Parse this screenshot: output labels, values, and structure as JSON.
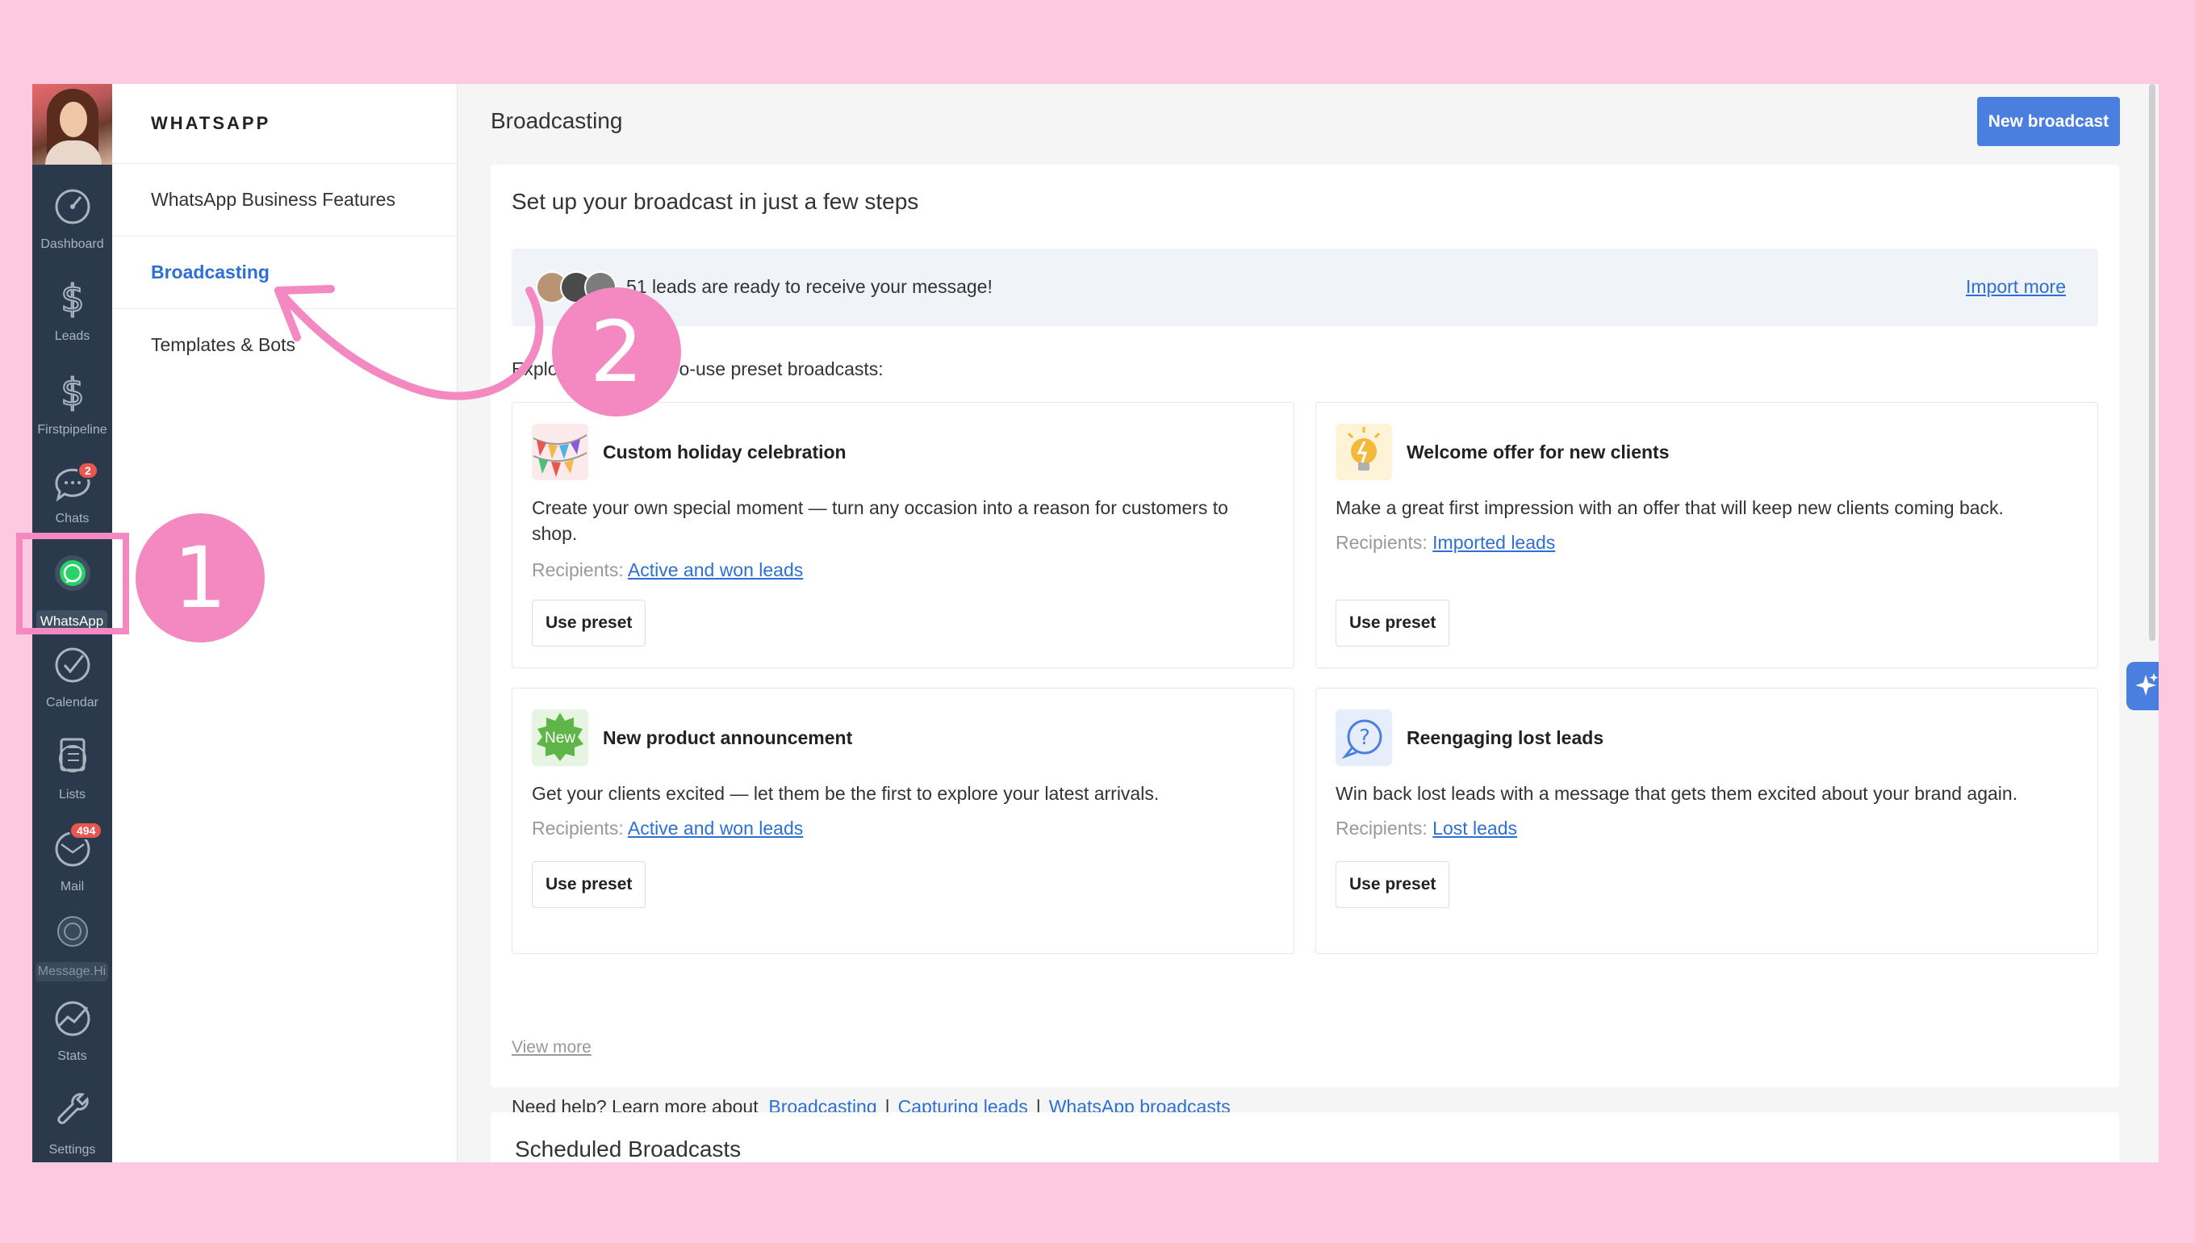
{
  "colors": {
    "background": "#fcc9e1",
    "rail": "#2a3a4c",
    "accent": "#4a7fe0",
    "link": "#2d6fd4",
    "annotation": "#f489c2",
    "badge": "#e8564f"
  },
  "rail": {
    "items": [
      {
        "label": "Dashboard",
        "icon": "dashboard-gauge-icon"
      },
      {
        "label": "Leads",
        "icon": "dollar-icon"
      },
      {
        "label": "Firstpipeline",
        "icon": "dollar-icon"
      },
      {
        "label": "Chats",
        "icon": "chat-bubble-icon",
        "badge": "2"
      },
      {
        "label": "WhatsApp",
        "icon": "whatsapp-icon"
      },
      {
        "label": "Calendar",
        "icon": "checkmark-circle-icon"
      },
      {
        "label": "Lists",
        "icon": "list-icon"
      },
      {
        "label": "Mail",
        "icon": "mail-icon",
        "badge": "494"
      },
      {
        "label": "Message.Hi",
        "icon": "whatsapp-icon"
      },
      {
        "label": "Stats",
        "icon": "stats-icon"
      },
      {
        "label": "Settings",
        "icon": "wrench-icon"
      }
    ]
  },
  "subnav": {
    "title": "WHATSAPP",
    "items": [
      {
        "label": "WhatsApp Business Features"
      },
      {
        "label": "Broadcasting"
      },
      {
        "label": "Templates & Bots"
      }
    ]
  },
  "header": {
    "title": "Broadcasting",
    "new_broadcast": "New broadcast"
  },
  "steps": {
    "title": "Set up your broadcast in just a few steps",
    "leads_text": "51 leads are ready to receive your message!",
    "import_more": "Import more",
    "explore_prefix": "Explo",
    "explore_suffix": "o-use preset broadcasts:",
    "recipients_label": "Recipients:",
    "presets": [
      {
        "name": "Custom holiday celebration",
        "icon": "bunting-flags-icon",
        "description": "Create your own special moment — turn any occasion into a reason for customers to shop.",
        "recipients": "Active and won leads",
        "button": "Use preset"
      },
      {
        "name": "Welcome offer for new clients",
        "icon": "lightbulb-icon",
        "description": "Make a great first impression with an offer that will keep new clients coming back.",
        "recipients": "Imported leads",
        "button": "Use preset"
      },
      {
        "name": "New product announcement",
        "icon": "new-badge-icon",
        "icon_text": "New",
        "description": "Get your clients excited — let them be the first to explore your latest arrivals.",
        "recipients": "Active and won leads",
        "button": "Use preset"
      },
      {
        "name": "Reengaging lost leads",
        "icon": "question-bubble-icon",
        "description": "Win back lost leads with a message that gets them excited about your brand again.",
        "recipients": "Lost leads",
        "button": "Use preset"
      }
    ],
    "view_more": "View more",
    "help": {
      "prefix": "Need help? Learn more about",
      "links": [
        "Broadcasting",
        "Capturing leads",
        "WhatsApp broadcasts"
      ],
      "separator": "|"
    }
  },
  "scheduled": {
    "title": "Scheduled Broadcasts"
  },
  "annotations": {
    "step1": "1",
    "step2": "2"
  }
}
